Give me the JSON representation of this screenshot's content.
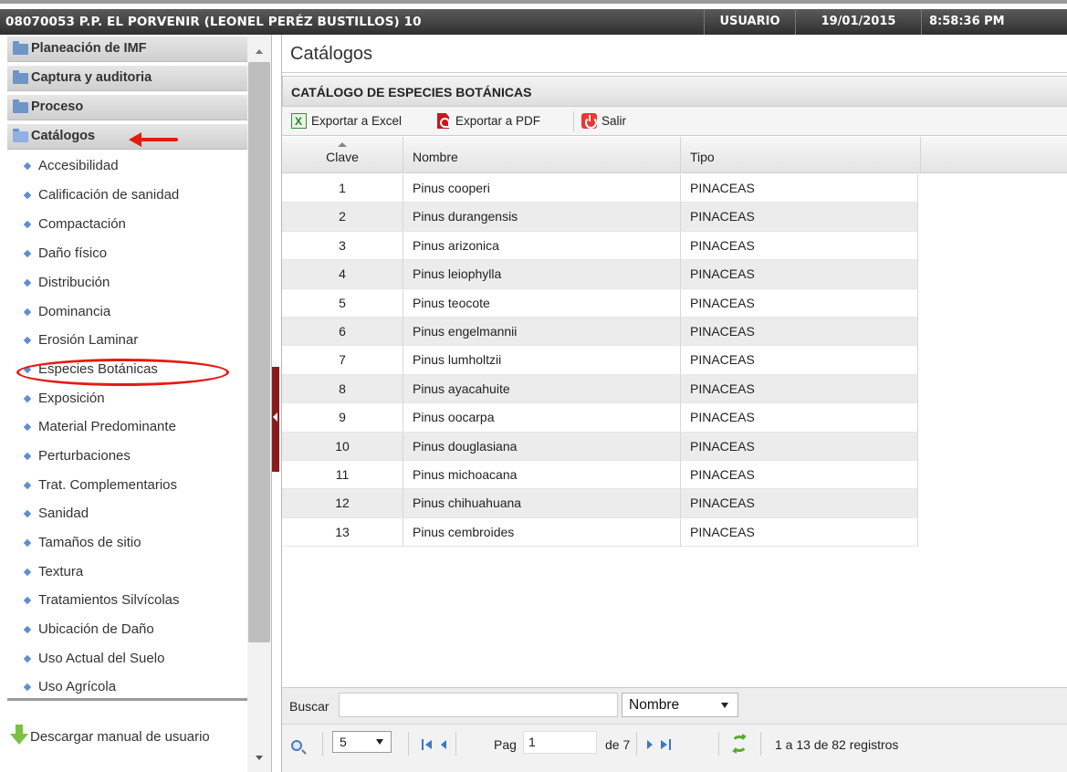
{
  "header": {
    "title": "08070053 P.P. EL PORVENIR (LEONEL PERÉZ BUSTILLOS) 10",
    "user": "USUARIO",
    "date": "19/01/2015",
    "time": "8:58:36 PM"
  },
  "sidebar": {
    "folders": [
      {
        "label": "Planeación de IMF",
        "icon": "folder-icon"
      },
      {
        "label": "Captura y auditoria",
        "icon": "folder-icon"
      },
      {
        "label": "Proceso",
        "icon": "folder-icon"
      },
      {
        "label": "Catálogos",
        "icon": "folder-open-icon"
      }
    ],
    "items": [
      {
        "label": "Accesibilidad"
      },
      {
        "label": "Calificación de sanidad"
      },
      {
        "label": "Compactación"
      },
      {
        "label": "Daño físico"
      },
      {
        "label": "Distribución"
      },
      {
        "label": "Dominancia"
      },
      {
        "label": "Erosión Laminar"
      },
      {
        "label": "Especies Botánicas"
      },
      {
        "label": "Exposición"
      },
      {
        "label": "Material Predominante"
      },
      {
        "label": "Perturbaciones"
      },
      {
        "label": "Trat. Complementarios"
      },
      {
        "label": "Sanidad"
      },
      {
        "label": "Tamaños de sitio"
      },
      {
        "label": "Textura"
      },
      {
        "label": "Tratamientos Silvícolas"
      },
      {
        "label": "Ubicación de Daño"
      },
      {
        "label": "Uso Actual del Suelo"
      },
      {
        "label": "Uso Agrícola"
      }
    ],
    "download_label": "Descargar manual de usuario"
  },
  "main": {
    "title": "Catálogos",
    "grid_title": "CATÁLOGO DE ESPECIES BOTÁNICAS",
    "toolbar": {
      "excel_label": "Exportar a Excel",
      "pdf_label": "Exportar a PDF",
      "exit_label": "Salir"
    },
    "table": {
      "columns": [
        "Clave",
        "Nombre",
        "Tipo"
      ],
      "rows": [
        {
          "clave": "1",
          "nombre": "Pinus cooperi",
          "tipo": "PINACEAS"
        },
        {
          "clave": "2",
          "nombre": "Pinus durangensis",
          "tipo": "PINACEAS"
        },
        {
          "clave": "3",
          "nombre": "Pinus arizonica",
          "tipo": "PINACEAS"
        },
        {
          "clave": "4",
          "nombre": "Pinus leiophylla",
          "tipo": "PINACEAS"
        },
        {
          "clave": "5",
          "nombre": "Pinus teocote",
          "tipo": "PINACEAS"
        },
        {
          "clave": "6",
          "nombre": "Pinus engelmannii",
          "tipo": "PINACEAS"
        },
        {
          "clave": "7",
          "nombre": "Pinus lumholtzii",
          "tipo": "PINACEAS"
        },
        {
          "clave": "8",
          "nombre": "Pinus ayacahuite",
          "tipo": "PINACEAS"
        },
        {
          "clave": "9",
          "nombre": "Pinus oocarpa",
          "tipo": "PINACEAS"
        },
        {
          "clave": "10",
          "nombre": "Pinus douglasiana",
          "tipo": "PINACEAS"
        },
        {
          "clave": "11",
          "nombre": "Pinus michoacana",
          "tipo": "PINACEAS"
        },
        {
          "clave": "12",
          "nombre": "Pinus chihuahuana",
          "tipo": "PINACEAS"
        },
        {
          "clave": "13",
          "nombre": "Pinus cembroides",
          "tipo": "PINACEAS"
        }
      ]
    },
    "search": {
      "label": "Buscar",
      "value": "",
      "field_selected": "Nombre"
    },
    "pager": {
      "page_size": "5",
      "page_label": "Pag",
      "page_value": "1",
      "of_label": "de 7",
      "records": "1 a 13 de 82 registros"
    }
  },
  "colors": {
    "annotation_red": "#e41b13",
    "title_bar": "#3a3a3a",
    "bullet_blue": "#5d8fd0"
  }
}
